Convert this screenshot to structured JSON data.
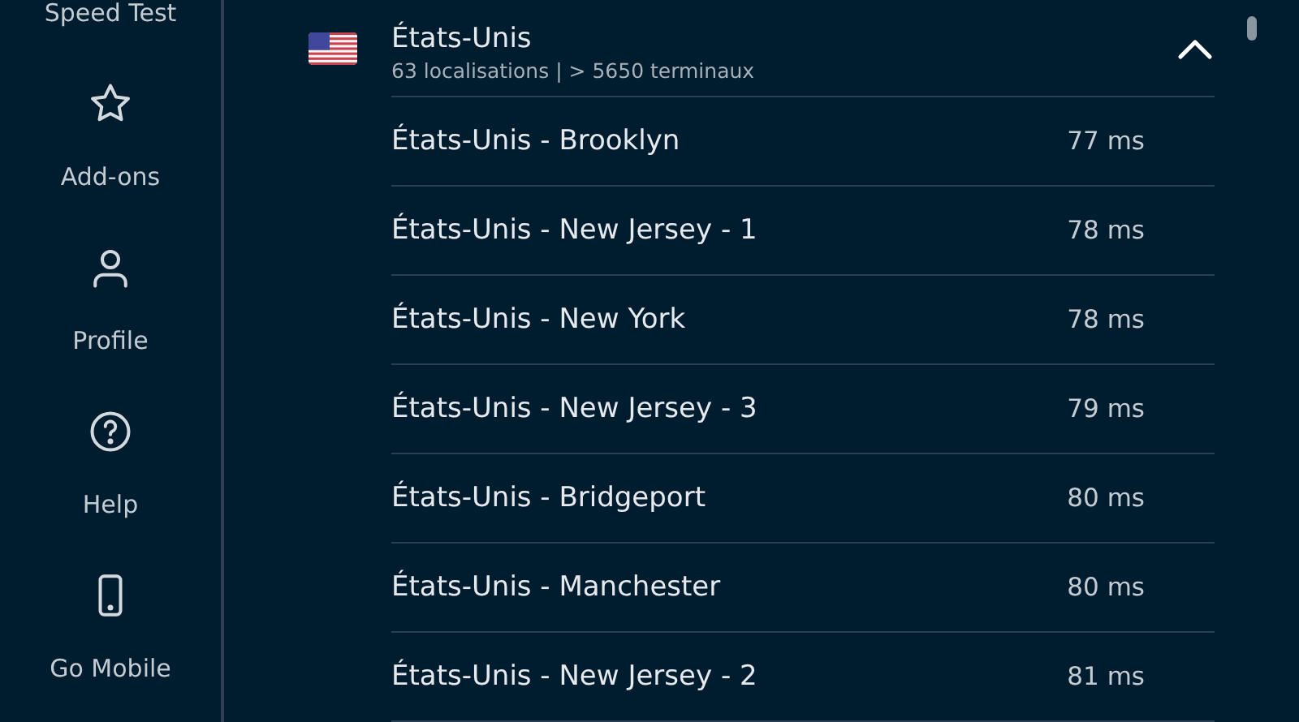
{
  "sidebar": {
    "items": [
      {
        "label": "Speed Test",
        "kind": "label-only"
      },
      {
        "label": "Add-ons",
        "kind": "star"
      },
      {
        "label": "Profile",
        "kind": "person"
      },
      {
        "label": "Help",
        "kind": "help"
      },
      {
        "label": "Go Mobile",
        "kind": "phone"
      }
    ]
  },
  "country": {
    "name": "États-Unis",
    "summary": "63 localisations | > 5650 terminaux",
    "expanded": true,
    "servers": [
      {
        "name": "États-Unis - Brooklyn",
        "ping": "77 ms"
      },
      {
        "name": "États-Unis - New Jersey - 1",
        "ping": "78 ms"
      },
      {
        "name": "États-Unis - New York",
        "ping": "78 ms"
      },
      {
        "name": "États-Unis - New Jersey - 3",
        "ping": "79 ms"
      },
      {
        "name": "États-Unis - Bridgeport",
        "ping": "80 ms"
      },
      {
        "name": "États-Unis - Manchester",
        "ping": "80 ms"
      },
      {
        "name": "États-Unis - New Jersey - 2",
        "ping": "81 ms"
      }
    ]
  }
}
